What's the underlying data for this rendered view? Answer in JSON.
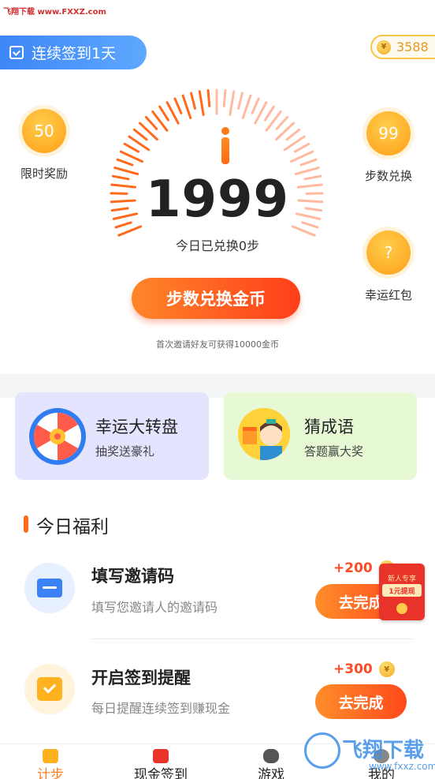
{
  "watermark_top": "飞翔下载 www.FXXZ.com",
  "checkin": {
    "label": "连续签到1天"
  },
  "coins": {
    "balance": "3588",
    "symbol": "¥"
  },
  "side_buttons": {
    "left": {
      "value": "50",
      "label": "限时奖励"
    },
    "right_top": {
      "value": "99",
      "label": "步数兑换"
    },
    "right_bottom": {
      "value": "?",
      "label": "幸运红包"
    }
  },
  "pedometer": {
    "steps": "1999",
    "exchanged_text": "今日已兑换0步"
  },
  "main_button": {
    "label": "步数兑换金币"
  },
  "invite_tip": "首次邀请好友可获得10000金币",
  "activity_cards": [
    {
      "title": "幸运大转盘",
      "subtitle": "抽奖送豪礼"
    },
    {
      "title": "猜成语",
      "subtitle": "答题赢大奖"
    }
  ],
  "section": {
    "title": "今日福利"
  },
  "tasks": [
    {
      "title": "填写邀请码",
      "desc": "填写您邀请人的邀请码",
      "reward": "+200",
      "button": "去完成"
    },
    {
      "title": "开启签到提醒",
      "desc": "每日提醒连续签到赚现金",
      "reward": "+300",
      "button": "去完成"
    }
  ],
  "floating_envelope": {
    "line1": "新人专享",
    "line2": "1元提现"
  },
  "tabs": [
    {
      "label": "计步",
      "active": true
    },
    {
      "label": "现金签到",
      "active": false
    },
    {
      "label": "游戏",
      "active": false
    },
    {
      "label": "我的",
      "active": false
    }
  ],
  "watermark_bottom": {
    "brand": "飞翔下载",
    "site": "www.fxxz.com"
  },
  "colors": {
    "accent": "#ff6a1c",
    "primary_blue": "#3d86f7",
    "gold": "#f7c642"
  }
}
